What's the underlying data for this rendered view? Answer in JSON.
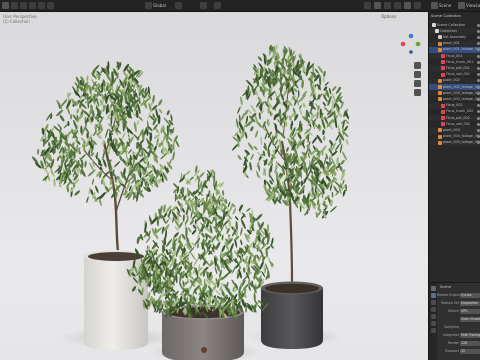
{
  "window": {
    "scene_label": "Scene",
    "view_layer_label": "ViewLayer",
    "viewport_shading_label": "Global"
  },
  "viewport": {
    "overlay_info": [
      "User Perspective",
      "(1) Collection"
    ],
    "options_label": "Options"
  },
  "outliner": {
    "title": "Scene Collection",
    "rows": [
      {
        "label": "Scene Collection",
        "depth": 0,
        "type": "collection"
      },
      {
        "label": "Collection",
        "depth": 1,
        "type": "collection"
      },
      {
        "label": "Set Assembly",
        "depth": 2,
        "type": "empty"
      },
      {
        "label": "plant_001",
        "depth": 2,
        "type": "object"
      },
      {
        "label": "plant_001_foliage_001",
        "depth": 2,
        "type": "object"
      },
      {
        "label": "Ficus_001",
        "depth": 3,
        "type": "mesh"
      },
      {
        "label": "Ficus_trunk_001",
        "depth": 3,
        "type": "mesh"
      },
      {
        "label": "Ficus_pot_001",
        "depth": 3,
        "type": "mesh"
      },
      {
        "label": "Ficus_soil_001",
        "depth": 3,
        "type": "mesh"
      },
      {
        "label": "plant_002",
        "depth": 2,
        "type": "object"
      },
      {
        "label": "plant_002_foliage_001",
        "depth": 2,
        "type": "object"
      },
      {
        "label": "plant_003_foliage_001",
        "depth": 2,
        "type": "object"
      },
      {
        "label": "plant_003_foliage_002",
        "depth": 2,
        "type": "object"
      },
      {
        "label": "Ficus_002",
        "depth": 3,
        "type": "mesh"
      },
      {
        "label": "Ficus_trunk_002",
        "depth": 3,
        "type": "mesh"
      },
      {
        "label": "Ficus_pot_002",
        "depth": 3,
        "type": "mesh"
      },
      {
        "label": "Ficus_soil_002",
        "depth": 3,
        "type": "mesh"
      },
      {
        "label": "plant_003",
        "depth": 2,
        "type": "object"
      },
      {
        "label": "plant_004_foliage_001",
        "depth": 2,
        "type": "object"
      },
      {
        "label": "plant_005_foliage_001",
        "depth": 2,
        "type": "object"
      }
    ]
  },
  "properties": {
    "header": "Scene",
    "fields": [
      {
        "label": "Render Engine",
        "value": "Cycles"
      },
      {
        "label": "Feature Set",
        "value": "Supported"
      },
      {
        "label": "Device",
        "value": "GPU"
      },
      {
        "label": "",
        "value": "Open Shading Language"
      },
      {
        "label": "Sampling",
        "value": ""
      },
      {
        "label": "Integrator",
        "value": "Path Tracing"
      },
      {
        "label": "Render",
        "value": "128"
      },
      {
        "label": "Viewport",
        "value": "32"
      }
    ]
  }
}
